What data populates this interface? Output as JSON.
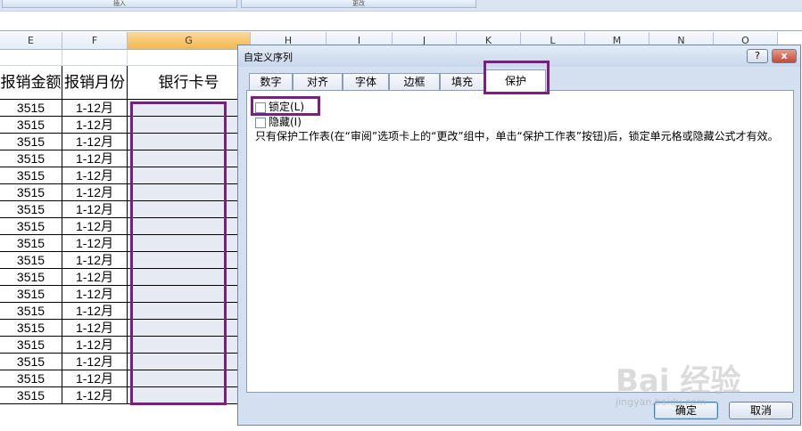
{
  "ribbon": {
    "buttons": [
      "插入",
      "更改"
    ]
  },
  "columns": [
    {
      "letter": "E"
    },
    {
      "letter": "F"
    },
    {
      "letter": "G",
      "selected": true
    },
    {
      "letter": "H"
    },
    {
      "letter": "I"
    },
    {
      "letter": "J"
    },
    {
      "letter": "K"
    },
    {
      "letter": "L"
    },
    {
      "letter": "M"
    },
    {
      "letter": "N"
    },
    {
      "letter": "O"
    }
  ],
  "sheet": {
    "headers": [
      "报销金额",
      "报销月份",
      "银行卡号"
    ],
    "rows": [
      [
        "3515",
        "1-12月",
        ""
      ],
      [
        "3515",
        "1-12月",
        ""
      ],
      [
        "3515",
        "1-12月",
        ""
      ],
      [
        "3515",
        "1-12月",
        ""
      ],
      [
        "3515",
        "1-12月",
        ""
      ],
      [
        "3515",
        "1-12月",
        ""
      ],
      [
        "3515",
        "1-12月",
        ""
      ],
      [
        "3515",
        "1-12月",
        ""
      ],
      [
        "3515",
        "1-12月",
        ""
      ],
      [
        "3515",
        "1-12月",
        ""
      ],
      [
        "3515",
        "1-12月",
        ""
      ],
      [
        "3515",
        "1-12月",
        ""
      ],
      [
        "3515",
        "1-12月",
        ""
      ],
      [
        "3515",
        "1-12月",
        ""
      ],
      [
        "3515",
        "1-12月",
        ""
      ],
      [
        "3515",
        "1-12月",
        ""
      ],
      [
        "3515",
        "1-12月",
        ""
      ],
      [
        "3515",
        "1-12月",
        ""
      ]
    ]
  },
  "dialog": {
    "title": "自定义序列",
    "help_label": "?",
    "close_label": "x",
    "tabs": [
      "数字",
      "对齐",
      "字体",
      "边框",
      "填充",
      "保护"
    ],
    "active_tab": "保护",
    "options": [
      {
        "label": "锁定(L)",
        "checked": false
      },
      {
        "label": "隐藏(I)",
        "checked": false
      }
    ],
    "description": "只有保护工作表(在“审阅”选项卡上的“更改”组中，单击“保护工作表”按钮)后，锁定单元格或隐藏公式才有效。",
    "ok_label": "确定",
    "cancel_label": "取消"
  },
  "watermark": {
    "brand": "Bai 经验",
    "url": "jingyan.baidu.com"
  },
  "colors": {
    "highlight": "#7a1f80",
    "selected_column": "#f5b84f",
    "cell_fill": "#e6eaf3"
  }
}
